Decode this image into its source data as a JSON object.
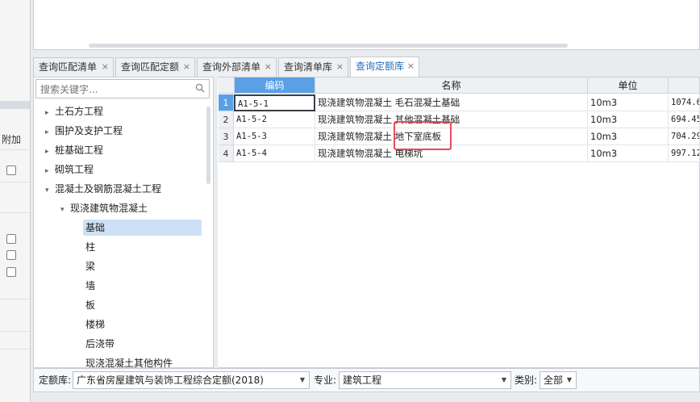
{
  "left_strip": {
    "column_label": "附加"
  },
  "tabs": [
    {
      "label": "查询匹配清单",
      "active": false
    },
    {
      "label": "查询匹配定额",
      "active": false
    },
    {
      "label": "查询外部清单",
      "active": false
    },
    {
      "label": "查询清单库",
      "active": false
    },
    {
      "label": "查询定额库",
      "active": true
    }
  ],
  "search": {
    "placeholder": "搜索关键字..."
  },
  "tree": [
    {
      "label": "土石方工程",
      "arrow": "▸"
    },
    {
      "label": "围护及支护工程",
      "arrow": "▸"
    },
    {
      "label": "桩基础工程",
      "arrow": "▸"
    },
    {
      "label": "砌筑工程",
      "arrow": "▸"
    },
    {
      "label": "混凝土及钢筋混凝土工程",
      "arrow": "▾"
    },
    {
      "label": "现浇建筑物混凝土",
      "arrow": "▾"
    },
    {
      "label": "基础",
      "arrow": "",
      "selected": true
    },
    {
      "label": "柱",
      "arrow": ""
    },
    {
      "label": "梁",
      "arrow": ""
    },
    {
      "label": "墙",
      "arrow": ""
    },
    {
      "label": "板",
      "arrow": ""
    },
    {
      "label": "楼梯",
      "arrow": ""
    },
    {
      "label": "后浇带",
      "arrow": ""
    },
    {
      "label": "现浇混凝土其他构件",
      "arrow": ""
    }
  ],
  "grid": {
    "headers": [
      "编码",
      "名称",
      "单位",
      ""
    ],
    "rows": [
      {
        "num": "1",
        "code": "A1-5-1",
        "name": "现浇建筑物混凝土 毛石混凝土基础",
        "unit": "10m3",
        "price": "1074.6"
      },
      {
        "num": "2",
        "code": "A1-5-2",
        "name": "现浇建筑物混凝土 其他混凝土基础",
        "unit": "10m3",
        "price": "694.45"
      },
      {
        "num": "3",
        "code": "A1-5-3",
        "name": "现浇建筑物混凝土 地下室底板",
        "unit": "10m3",
        "price": "704.29"
      },
      {
        "num": "4",
        "code": "A1-5-4",
        "name": "现浇建筑物混凝土 电梯坑",
        "unit": "10m3",
        "price": "997.12"
      }
    ]
  },
  "bottom": {
    "lib_label": "定额库:",
    "lib_value": "广东省房屋建筑与装饰工程综合定额(2018)",
    "major_label": "专业:",
    "major_value": "建筑工程",
    "category_label": "类别:",
    "category_value": "全部"
  }
}
